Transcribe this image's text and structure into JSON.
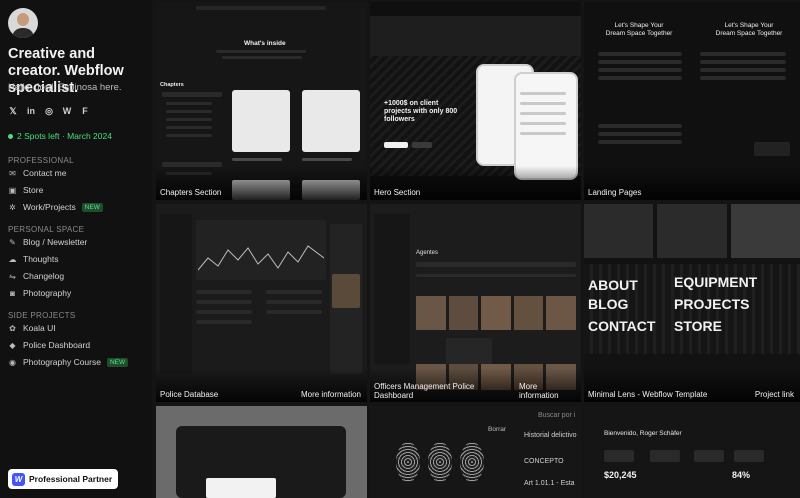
{
  "profile": {
    "headline": "Creative and creator. Webflow specialist.",
    "greeting": "Hello, Jordi Espinosa here.",
    "availability": "2 Spots left · March 2024"
  },
  "socials": [
    "twitter-icon",
    "linkedin-icon",
    "instagram-icon",
    "webflow-icon",
    "framer-icon"
  ],
  "nav": {
    "professional_title": "PROFESSIONAL",
    "professional": [
      {
        "label": "Contact me",
        "icon": "contact-icon"
      },
      {
        "label": "Store",
        "icon": "store-icon"
      },
      {
        "label": "Work/Projects",
        "icon": "projects-icon",
        "badge": "NEW"
      }
    ],
    "personal_title": "PERSONAL SPACE",
    "personal": [
      {
        "label": "Blog / Newsletter",
        "icon": "blog-icon"
      },
      {
        "label": "Thoughts",
        "icon": "thoughts-icon"
      },
      {
        "label": "Changelog",
        "icon": "changelog-icon"
      },
      {
        "label": "Photography",
        "icon": "camera-icon"
      }
    ],
    "side_title": "SIDE PROJECTS",
    "side": [
      {
        "label": "Koala UI",
        "icon": "koala-icon"
      },
      {
        "label": "Police Dashboard",
        "icon": "police-icon"
      },
      {
        "label": "Photography Course",
        "icon": "course-icon",
        "badge": "NEW"
      }
    ]
  },
  "partner_badge": "Professional Partner",
  "tiles": {
    "chapters": {
      "label": "Chapters Section",
      "heading": "What's inside",
      "side_title": "Chapters"
    },
    "hero": {
      "label": "Hero Section",
      "headline": "+1000$ on client projects with only 800 followers"
    },
    "landing": {
      "label": "Landing Pages",
      "heading": "Let's Shape Your Dream Space Together"
    },
    "police": {
      "label": "Police Database",
      "more": "More information"
    },
    "officers": {
      "label": "Officers Management Police Dashboard",
      "more": "More information",
      "panel_title": "Agentes"
    },
    "minimal": {
      "label": "Minimal Lens - Webflow Template",
      "more": "Project link",
      "words": [
        "ABOUT",
        "BLOG",
        "CONTACT",
        "EQUIPMENT",
        "PROJECTS",
        "STORE"
      ]
    },
    "police2": {
      "search": "Buscar por i",
      "erase": "Borrar",
      "hist": "Historial delictivo",
      "concept": "CONCEPTO",
      "art": "Art 1.01.1 - Esta"
    },
    "dash": {
      "welcome": "Bienvenido, Roger Schäfer",
      "stat1": "$20,245",
      "stat2": "84%"
    }
  },
  "colors": {
    "accent_green": "#4ade80",
    "webflow_blue": "#4353ff"
  }
}
